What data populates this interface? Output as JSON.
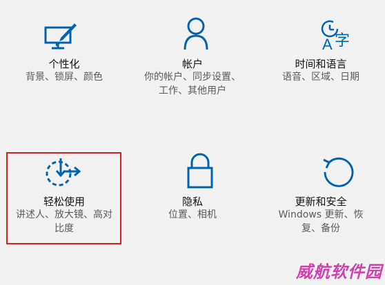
{
  "colors": {
    "background": "#f2f2f2",
    "icon_blue": "#0063b1",
    "highlight_red": "#d81e1e",
    "watermark": "#d040b0"
  },
  "tiles": [
    {
      "title": "个性化",
      "desc_lines": [
        "背景、锁屏、颜色"
      ],
      "icon": "personalization-monitor-brush-icon"
    },
    {
      "title": "帐户",
      "desc_lines": [
        "你的帐户、同步设置、",
        "工作、其他用户"
      ],
      "icon": "account-person-icon"
    },
    {
      "title": "时间和语言",
      "desc_lines": [
        "语音、区域、日期"
      ],
      "icon": "time-language-icon"
    },
    {
      "title": "轻松使用",
      "desc_lines": [
        "讲述人、放大镜、高对",
        "比度"
      ],
      "icon": "ease-of-access-icon"
    },
    {
      "title": "隐私",
      "desc_lines": [
        "位置、相机"
      ],
      "icon": "privacy-lock-icon"
    },
    {
      "title": "更新和安全",
      "desc_lines": [
        "Windows 更新、恢",
        "复、备份"
      ],
      "icon": "update-refresh-icon"
    }
  ],
  "watermark": "威航软件园"
}
